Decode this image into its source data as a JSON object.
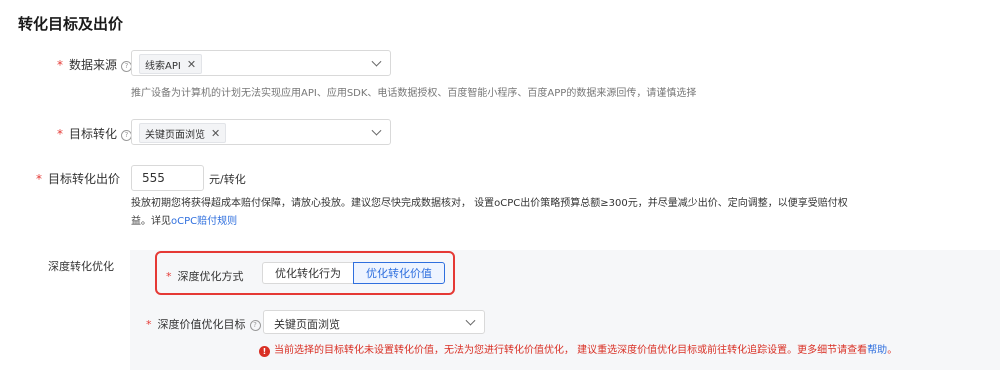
{
  "section_title": "转化目标及出价",
  "data_source": {
    "label": "数据来源",
    "tag": "线索API",
    "hint": "推广设备为计算机的计划无法实现应用API、应用SDK、电话数据授权、百度智能小程序、百度APP的数据来源回传，请谨慎选择"
  },
  "target_conversion": {
    "label": "目标转化",
    "tag": "关键页面浏览"
  },
  "bid": {
    "label": "目标转化出价",
    "value": "555",
    "unit": "元/转化",
    "desc_line1": "投放初期您将获得超成本赔付保障，请放心投放。建议您尽快完成数据核对， 设置oCPC出价策略预算总额≥300元，并尽量减少出价、定向调整，以便享受赔付权",
    "desc_line2_prefix": "益。详见",
    "desc_link": "oCPC赔付规则"
  },
  "deep": {
    "section_label": "深度转化优化",
    "mode_label": "深度优化方式",
    "option_behavior": "优化转化行为",
    "option_value": "优化转化价值",
    "target_label": "深度价值优化目标",
    "target_value": "关键页面浏览",
    "warning_text": "当前选择的目标转化未设置转化价值，无法为您进行转化价值优化， 建议重选深度价值优化目标或前往转化追踪设置。更多细节请查看",
    "warning_link": "帮助",
    "warning_end": "。"
  },
  "colors": {
    "accent": "#2f6fde",
    "required": "#e53935",
    "warning": "#d93025"
  }
}
